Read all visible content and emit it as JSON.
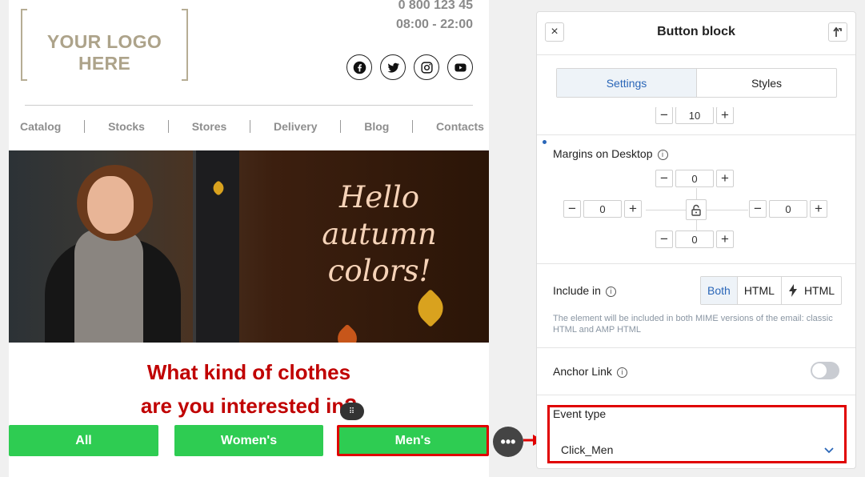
{
  "email": {
    "logo_text": "YOUR LOGO HERE",
    "phone": "0 800 123 45",
    "hours": "08:00 - 22:00",
    "socials": [
      "facebook-icon",
      "twitter-icon",
      "instagram-icon",
      "youtube-icon"
    ],
    "nav": [
      "Catalog",
      "Stocks",
      "Stores",
      "Delivery",
      "Blog",
      "Contacts"
    ],
    "banner_text": [
      "Hello",
      "autumn",
      "colors!"
    ],
    "question_line1": "What kind of clothes",
    "question_line2": "are you interested in?",
    "buttons": {
      "all": "All",
      "women": "Women's",
      "men": "Men's"
    },
    "drag_handle": "⠿",
    "more_button": "•••"
  },
  "panel": {
    "title": "Button block",
    "close_label": "×",
    "tabs": {
      "settings": "Settings",
      "styles": "Styles"
    },
    "partial_stepper_value": "10",
    "margins_label": "Margins on Desktop",
    "margins": {
      "top": "0",
      "left": "0",
      "right": "0",
      "bottom": "0"
    },
    "stepper_minus": "−",
    "stepper_plus": "+",
    "include_label": "Include in",
    "include_options": {
      "both": "Both",
      "html": "HTML",
      "amp": "HTML"
    },
    "include_note": "The element will be included in both MIME versions of the email: classic HTML and AMP HTML",
    "anchor_label": "Anchor Link",
    "anchor_enabled": false,
    "event_label": "Event type",
    "event_value": "Click_Men",
    "info_glyph": "i"
  },
  "colors": {
    "cta_green": "#2ecc52",
    "highlight_red": "#e00000",
    "question_red": "#c00000",
    "accent_blue": "#2a66b8"
  }
}
